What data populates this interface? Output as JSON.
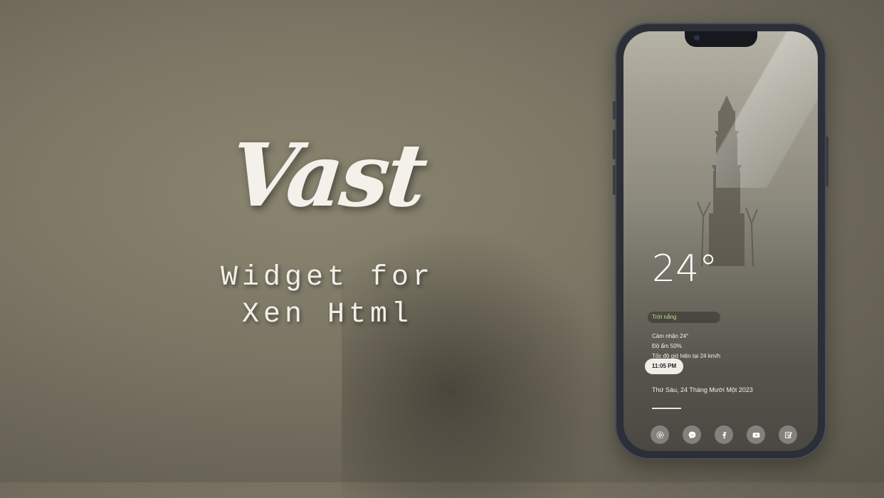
{
  "promo": {
    "title": "Vast",
    "subtitle_line1": "Widget for",
    "subtitle_line2": "Xen Html"
  },
  "widget": {
    "temperature": "24°",
    "condition": "Trời nắng",
    "feels_like": "Cảm nhận 24°",
    "humidity": "Độ ẩm 50%",
    "wind": "Tốc độ gió hiện tại 24 km/h",
    "time": "11:05 PM",
    "date": "Thứ Sáu, 24 Tháng Mười Một 2023",
    "condition_color": "#b8e08a"
  },
  "dock": {
    "items": [
      {
        "icon": "settings-icon"
      },
      {
        "icon": "messenger-icon"
      },
      {
        "icon": "facebook-icon"
      },
      {
        "icon": "youtube-icon"
      },
      {
        "icon": "notes-icon"
      }
    ]
  }
}
